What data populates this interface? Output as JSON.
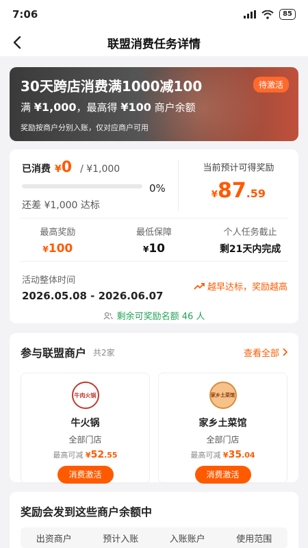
{
  "status_bar": {
    "time": "7:06",
    "battery": "85"
  },
  "nav": {
    "title": "联盟消费任务详情"
  },
  "banner": {
    "title": "30天跨店消费满1000减100",
    "subtitle_prefix": "满",
    "subtitle_amount1": "¥1,000",
    "subtitle_mid": "，最高得",
    "subtitle_amount2": "¥100",
    "subtitle_suffix": "商户余额",
    "note": "奖励按商户分别入账，仅对应商户可用",
    "badge": "待激活"
  },
  "progress": {
    "spent_label": "已消费",
    "spent_currency": "¥",
    "spent_value": "0",
    "spent_total": "/ ¥1,000",
    "percent": "0%",
    "progress_fraction": 0,
    "gap_text": "还差 ¥1,000 达标",
    "expect_label": "当前预计可得奖励",
    "expect_currency": "¥",
    "expect_int": "87",
    "expect_dec": ".59"
  },
  "stats": [
    {
      "label": "最高奖励",
      "currency": "¥",
      "value": "100"
    },
    {
      "label": "最低保障",
      "currency": "¥",
      "value": "10"
    },
    {
      "label": "个人任务截止",
      "value": "剩21天内完成"
    }
  ],
  "period": {
    "label": "活动整体时间",
    "value": "2026.05.08 - 2026.06.07",
    "early_text": "越早达标，奖励越高",
    "remaining": "剩余可奖励名额 46 人"
  },
  "merchants_section": {
    "title": "参与联盟商户",
    "count": "共2家",
    "view_all": "查看全部",
    "items": [
      {
        "name": "牛火锅",
        "logo_text": "牛肉火锅",
        "scope": "全部门店",
        "max_label": "最高可减",
        "currency": "¥",
        "amount_int": "52",
        "amount_dec": ".55",
        "button": "消费激活"
      },
      {
        "name": "家乡土菜馆",
        "logo_text": "家乡土菜馆",
        "scope": "全部门店",
        "max_label": "最高可减",
        "currency": "¥",
        "amount_int": "35",
        "amount_dec": ".04",
        "button": "消费激活"
      }
    ]
  },
  "reward_section": {
    "title": "奖励会发到这些商户余额中",
    "columns": [
      "出资商户",
      "预计入账",
      "入账账户",
      "使用范围"
    ]
  },
  "colors": {
    "accent": "#ff5a00",
    "green": "#22a356"
  }
}
